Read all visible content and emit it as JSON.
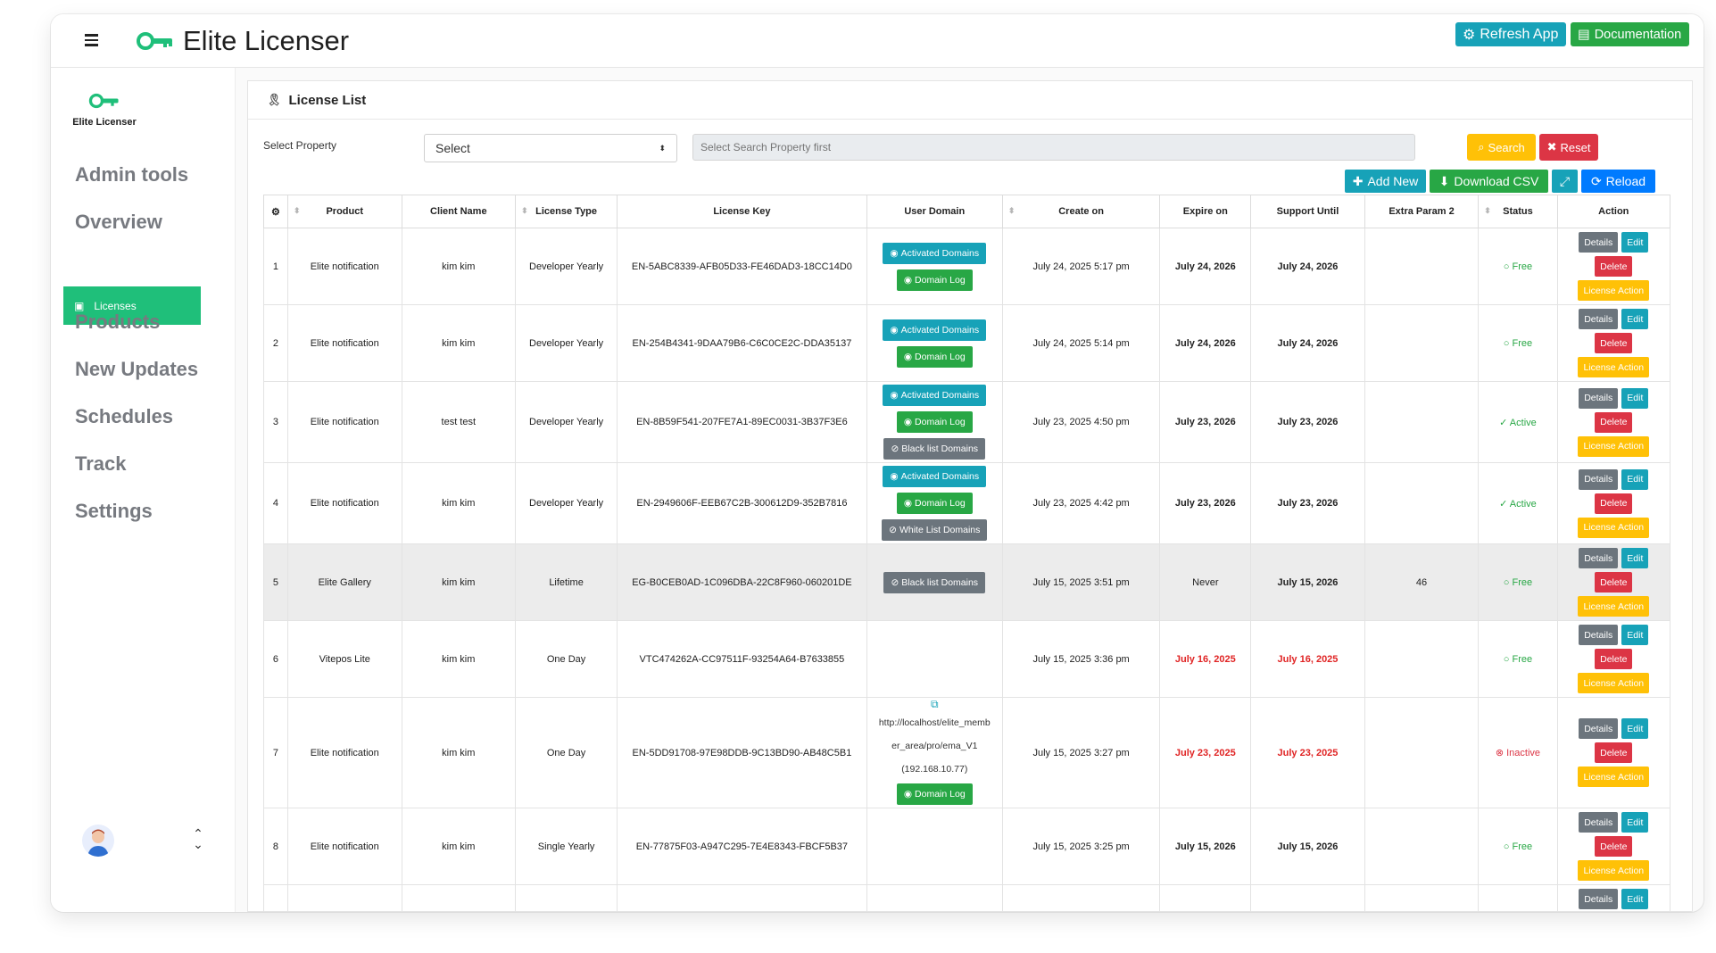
{
  "app": {
    "title": "Elite Licenser",
    "refresh_label": "Refresh App",
    "doc_label": "Documentation"
  },
  "sidebar": {
    "logo_label": "Elite Licenser",
    "items": [
      {
        "label": "Admin tools"
      },
      {
        "label": "Overview"
      },
      {
        "label": "Licenses"
      },
      {
        "label": "Products"
      },
      {
        "label": "New Updates"
      },
      {
        "label": "Schedules"
      },
      {
        "label": "Track"
      },
      {
        "label": "Settings"
      }
    ]
  },
  "page": {
    "heading": "License List",
    "filter_label": "Select Property",
    "select_value": "Select",
    "search_placeholder": "Select Search Property first",
    "search_label": "Search",
    "reset_label": "Reset",
    "add_new_label": "Add New",
    "csv_label": "Download CSV",
    "reload_label": "Reload"
  },
  "table": {
    "headers": [
      "Product",
      "Client Name",
      "License Type",
      "License Key",
      "User Domain",
      "Create on",
      "Expire on",
      "Support Until",
      "Extra Param 2",
      "Status",
      "Action"
    ],
    "buttons": {
      "activated": "Activated Domains",
      "domain_log": "Domain Log",
      "black_list": "Black list Domains",
      "white_list": "White List Domains",
      "details": "Details",
      "edit": "Edit",
      "delete": "Delete",
      "license_action": "License Action"
    },
    "rows": [
      {
        "num": "1",
        "product": "Elite notification",
        "client": "kim kim",
        "type": "Developer Yearly",
        "key": "EN-5ABC8339-AFB05D33-FE46DAD3-18CC14D0",
        "created": "July 24, 2025 5:17 pm",
        "expire": "July 24, 2026",
        "support": "July 24, 2026",
        "extra": "",
        "status": "Free"
      },
      {
        "num": "2",
        "product": "Elite notification",
        "client": "kim kim",
        "type": "Developer Yearly",
        "key": "EN-254B4341-9DAA79B6-C6C0CE2C-DDA35137",
        "created": "July 24, 2025 5:14 pm",
        "expire": "July 24, 2026",
        "support": "July 24, 2026",
        "extra": "",
        "status": "Free"
      },
      {
        "num": "3",
        "product": "Elite notification",
        "client": "test test",
        "type": "Developer Yearly",
        "key": "EN-8B59F541-207FE7A1-89EC0031-3B37F3E6",
        "created": "July 23, 2025 4:50 pm",
        "expire": "July 23, 2026",
        "support": "July 23, 2026",
        "extra": "",
        "status": "Active"
      },
      {
        "num": "4",
        "product": "Elite notification",
        "client": "kim kim",
        "type": "Developer Yearly",
        "key": "EN-2949606F-EEB67C2B-300612D9-352B7816",
        "created": "July 23, 2025 4:42 pm",
        "expire": "July 23, 2026",
        "support": "July 23, 2026",
        "extra": "",
        "status": "Active"
      },
      {
        "num": "5",
        "product": "Elite Gallery",
        "client": "kim kim",
        "type": "Lifetime",
        "key": "EG-B0CEB0AD-1C096DBA-22C8F960-060201DE",
        "created": "July 15, 2025 3:51 pm",
        "expire": "Never",
        "support": "July 15, 2026",
        "extra": "46",
        "status": "Free"
      },
      {
        "num": "6",
        "product": "Vitepos Lite",
        "client": "kim kim",
        "type": "One Day",
        "key": "VTC474262A-CC97511F-93254A64-B7633855",
        "created": "July 15, 2025 3:36 pm",
        "expire": "July 16, 2025",
        "support": "July 16, 2025",
        "extra": "",
        "status": "Free"
      },
      {
        "num": "7",
        "product": "Elite notification",
        "client": "kim kim",
        "type": "One Day",
        "key": "EN-5DD91708-97E98DDB-9C13BD90-AB48C5B1",
        "created": "July 15, 2025 3:27 pm",
        "expire": "July 23, 2025",
        "support": "July 23, 2025",
        "extra": "",
        "status": "Inactive",
        "domain_line1": "http://localhost/elite_memb",
        "domain_line2": "er_area/pro/ema_V1",
        "domain_line3": "(192.168.10.77)"
      },
      {
        "num": "8",
        "product": "Elite notification",
        "client": "kim kim",
        "type": "Single Yearly",
        "key": "EN-77875F03-A947C295-7E4E8343-FBCF5B37",
        "created": "July 15, 2025 3:25 pm",
        "expire": "July 15, 2026",
        "support": "July 15, 2026",
        "extra": "",
        "status": "Free"
      }
    ]
  }
}
